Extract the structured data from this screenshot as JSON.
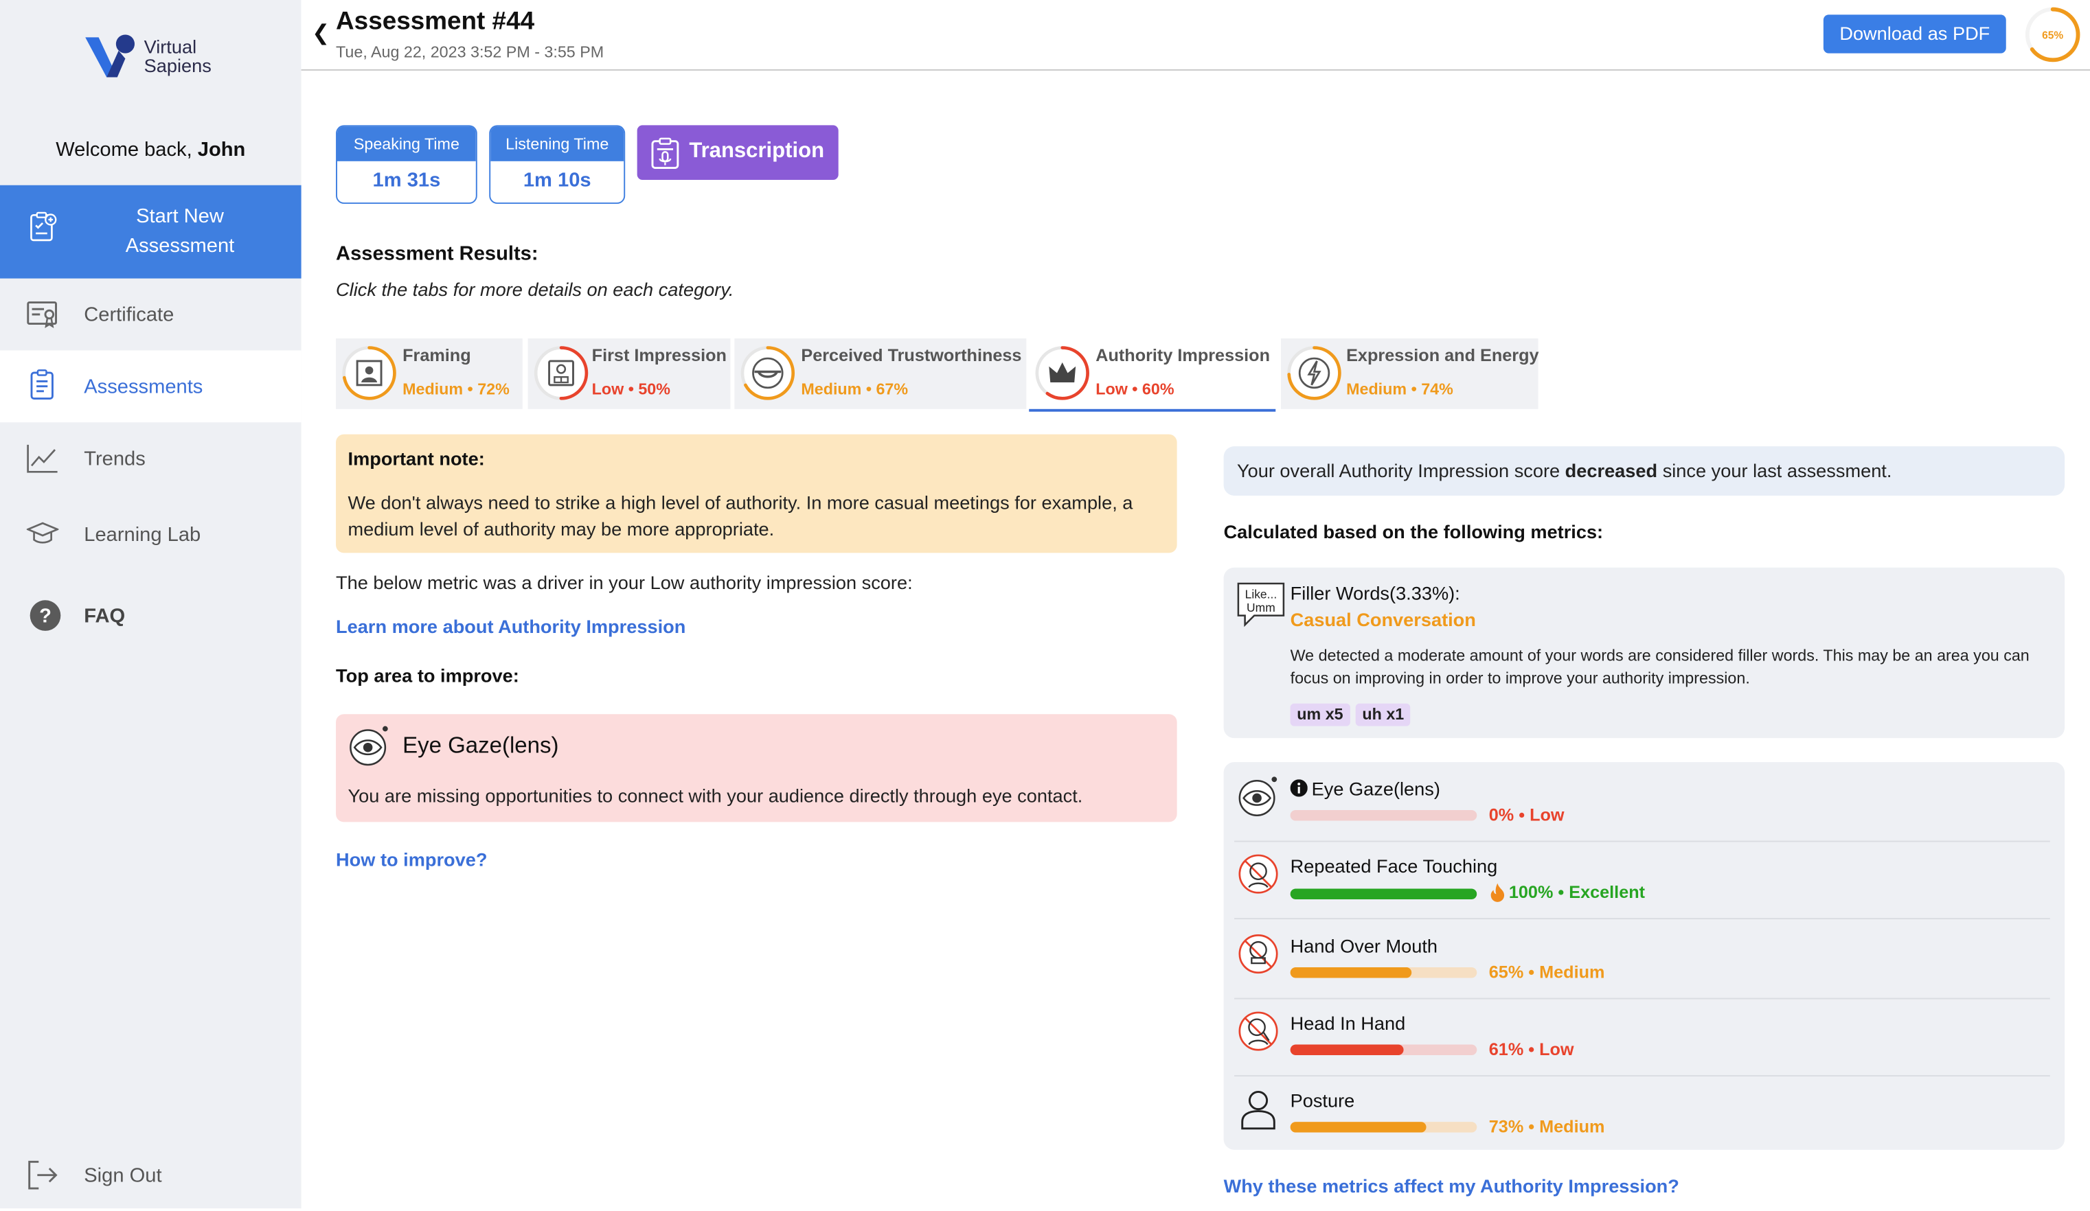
{
  "brand": {
    "line1": "Virtual",
    "line2": "Sapiens"
  },
  "welcome": {
    "prefix": "Welcome back,",
    "name": "John"
  },
  "nav": {
    "start_line1": "Start New",
    "start_line2": "Assessment",
    "certificate": "Certificate",
    "assessments": "Assessments",
    "trends": "Trends",
    "learning_lab": "Learning Lab",
    "faq": "FAQ",
    "sign_out": "Sign Out"
  },
  "header": {
    "title": "Assessment #44",
    "subtitle": "Tue, Aug 22, 2023 3:52 PM - 3:55 PM",
    "download_label": "Download as PDF",
    "overall_score": "65%",
    "overall_score_value": 0.65
  },
  "stats": {
    "speaking_label": "Speaking Time",
    "speaking_value": "1m 31s",
    "listening_label": "Listening Time",
    "listening_value": "1m 10s",
    "transcription_label": "Transcription"
  },
  "results": {
    "title": "Assessment Results:",
    "subtitle": "Click the tabs for more details on each category."
  },
  "tabs": [
    {
      "label": "Framing",
      "level": "Medium",
      "pct": "72%",
      "value": 0.72,
      "color": "#f09a1c"
    },
    {
      "label": "First Impression",
      "level": "Low",
      "pct": "50%",
      "value": 0.5,
      "color": "#e8432c"
    },
    {
      "label": "Perceived Trustworthiness",
      "level": "Medium",
      "pct": "67%",
      "value": 0.67,
      "color": "#f09a1c"
    },
    {
      "label": "Authority Impression",
      "level": "Low",
      "pct": "60%",
      "value": 0.6,
      "color": "#e8432c"
    },
    {
      "label": "Expression and Energy",
      "level": "Medium",
      "pct": "74%",
      "value": 0.74,
      "color": "#f09a1c"
    }
  ],
  "note": {
    "title": "Important note:",
    "body": "We don't always need to strike a high level of authority. In more casual meetings for example, a medium level of authority may be more appropriate."
  },
  "driver_text": "The below metric was a driver in your Low authority impression score:",
  "learn_more": "Learn more about Authority Impression",
  "improve": {
    "title": "Top area to improve:",
    "metric": "Eye Gaze(lens)",
    "description": "You are missing opportunities to connect with your audience directly through eye contact.",
    "how_link": "How to improve?"
  },
  "overall_change": {
    "prefix": "Your overall Authority Impression score",
    "emphasis": "decreased",
    "suffix": "since your last assessment."
  },
  "calculated_title": "Calculated based on the following metrics:",
  "filler": {
    "icon_line1": "Like...",
    "icon_line2": "Umm",
    "title": "Filler Words(3.33%):",
    "subtitle": "Casual Conversation",
    "description": "We detected a moderate amount of your words are considered filler words. This may be an area you can focus on improving in order to improve your authority impression.",
    "chips": [
      "um x5",
      "uh x1"
    ]
  },
  "metrics": [
    {
      "name": "Eye Gaze(lens)",
      "score": "0% • Low",
      "value": 0.0,
      "color": "#e8432c"
    },
    {
      "name": "Repeated Face Touching",
      "score": "100% • Excellent",
      "value": 1.0,
      "color": "#27a522"
    },
    {
      "name": "Hand Over Mouth",
      "score": "65% • Medium",
      "value": 0.65,
      "color": "#f09a1c"
    },
    {
      "name": "Head In Hand",
      "score": "61% • Low",
      "value": 0.61,
      "color": "#e8432c"
    },
    {
      "name": "Posture",
      "score": "73% • Medium",
      "value": 0.73,
      "color": "#f09a1c"
    }
  ],
  "why_link": "Why these metrics affect my Authority Impression?"
}
